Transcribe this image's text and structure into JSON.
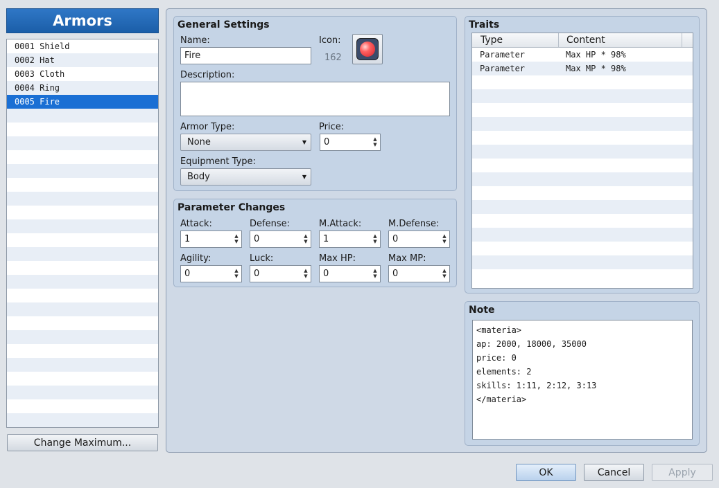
{
  "sidebar": {
    "title": "Armors",
    "items": [
      {
        "label": "0001 Shield"
      },
      {
        "label": "0002 Hat"
      },
      {
        "label": "0003 Cloth"
      },
      {
        "label": "0004 Ring"
      },
      {
        "label": "0005 Fire",
        "selected": true
      }
    ],
    "change_max_label": "Change Maximum..."
  },
  "general": {
    "title": "General Settings",
    "name_label": "Name:",
    "name_value": "Fire",
    "icon_label": "Icon:",
    "icon_index": "162",
    "icon_name": "red-orb-icon",
    "description_label": "Description:",
    "description_value": "",
    "armor_type_label": "Armor Type:",
    "armor_type_value": "None",
    "price_label": "Price:",
    "price_value": "0",
    "equip_type_label": "Equipment Type:",
    "equip_type_value": "Body"
  },
  "params": {
    "title": "Parameter Changes",
    "attack_label": "Attack:",
    "attack_value": "1",
    "defense_label": "Defense:",
    "defense_value": "0",
    "mattack_label": "M.Attack:",
    "mattack_value": "1",
    "mdefense_label": "M.Defense:",
    "mdefense_value": "0",
    "agility_label": "Agility:",
    "agility_value": "0",
    "luck_label": "Luck:",
    "luck_value": "0",
    "maxhp_label": "Max HP:",
    "maxhp_value": "0",
    "maxmp_label": "Max MP:",
    "maxmp_value": "0"
  },
  "traits": {
    "title": "Traits",
    "col_type": "Type",
    "col_content": "Content",
    "rows": [
      {
        "type": "Parameter",
        "content": "Max HP * 98%"
      },
      {
        "type": "Parameter",
        "content": "Max MP * 98%"
      }
    ]
  },
  "note": {
    "title": "Note",
    "text": "<materia>\nap: 2000, 18000, 35000\nprice: 0\nelements: 2\nskills: 1:11, 2:12, 3:13\n</materia>"
  },
  "buttons": {
    "ok": "OK",
    "cancel": "Cancel",
    "apply": "Apply"
  },
  "colors": {
    "accent": "#1a6fd4",
    "panel": "#c5d4e6"
  }
}
